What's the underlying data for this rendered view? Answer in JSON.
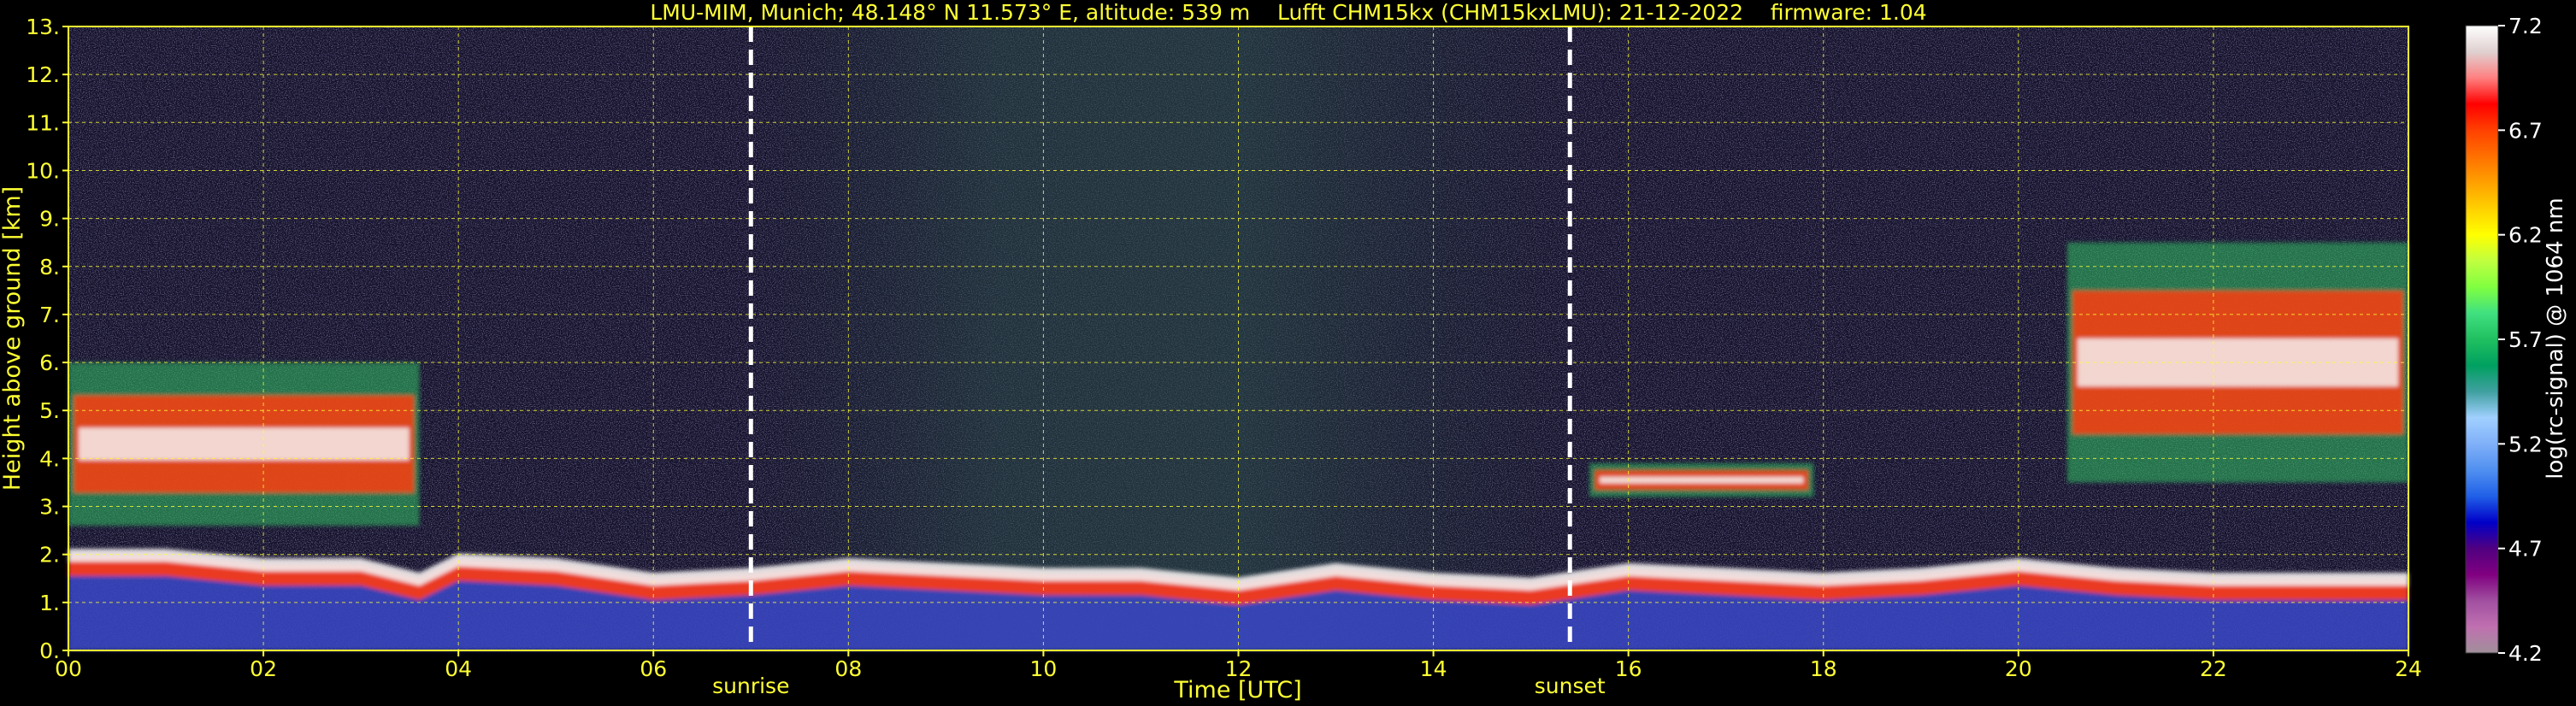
{
  "chart_data": {
    "type": "heatmap",
    "title": "LMU-MIM, Munich; 48.148° N 11.573° E, altitude: 539 m    Lufft CHM15kx (CHM15kxLMU): 21-12-2022    firmware: 1.04",
    "xlabel": "Time [UTC]",
    "ylabel": "Height above ground [km]",
    "colorbar_label": "log(rc-signal) @ 1064 nm",
    "xlim": [
      0,
      24
    ],
    "ylim": [
      0,
      13
    ],
    "x_ticks": [
      0,
      2,
      4,
      6,
      8,
      10,
      12,
      14,
      16,
      18,
      20,
      22,
      24
    ],
    "x_tick_labels": [
      "00",
      "02",
      "04",
      "06",
      "08",
      "10",
      "12",
      "14",
      "16",
      "18",
      "20",
      "22",
      "24"
    ],
    "y_ticks": [
      0,
      1,
      2,
      3,
      4,
      5,
      6,
      7,
      8,
      9,
      10,
      11,
      12,
      13
    ],
    "y_tick_labels": [
      "0.",
      "1.",
      "2.",
      "3.",
      "4.",
      "5.",
      "6.",
      "7.",
      "8.",
      "9.",
      "10.",
      "11.",
      "12.",
      "13."
    ],
    "grid": true,
    "colorbar": {
      "min": 4.2,
      "max": 7.2,
      "ticks": [
        4.2,
        4.7,
        5.2,
        5.7,
        6.2,
        6.7,
        7.2
      ],
      "tick_labels": [
        "4.2",
        "4.7",
        "5.2",
        "5.7",
        "6.2",
        "6.7",
        "7.2"
      ],
      "colors": [
        "#a0909a",
        "#c070b0",
        "#a050a0",
        "#800080",
        "#500080",
        "#0000c8",
        "#2060e8",
        "#5090f0",
        "#80b0f8",
        "#a0d0ff",
        "#40a0a0",
        "#00a060",
        "#20c060",
        "#40e080",
        "#80ff40",
        "#c0ff40",
        "#ffff00",
        "#ffd000",
        "#ffa000",
        "#ff7000",
        "#ff4000",
        "#ff0000",
        "#ff8080",
        "#e0d0d0",
        "#ffffff"
      ]
    },
    "events": [
      {
        "label": "sunrise",
        "x": 7.0
      },
      {
        "label": "sunset",
        "x": 15.4
      }
    ],
    "layers": [
      {
        "name": "aerosol-layer",
        "points": [
          [
            0,
            2.0
          ],
          [
            1,
            2.0
          ],
          [
            2,
            1.8
          ],
          [
            3,
            1.8
          ],
          [
            3.6,
            1.5
          ],
          [
            4,
            1.9
          ],
          [
            5,
            1.8
          ],
          [
            6,
            1.5
          ],
          [
            7,
            1.6
          ],
          [
            8,
            1.8
          ],
          [
            9,
            1.7
          ],
          [
            10,
            1.6
          ],
          [
            11,
            1.6
          ],
          [
            12,
            1.4
          ],
          [
            13,
            1.7
          ],
          [
            14,
            1.5
          ],
          [
            15,
            1.4
          ],
          [
            16,
            1.7
          ],
          [
            17,
            1.6
          ],
          [
            18,
            1.5
          ],
          [
            19,
            1.6
          ],
          [
            20,
            1.8
          ],
          [
            21,
            1.6
          ],
          [
            22,
            1.5
          ],
          [
            23,
            1.5
          ],
          [
            24,
            1.5
          ]
        ]
      },
      {
        "name": "cloud-early-morning",
        "x_start": 0,
        "x_end": 3.6,
        "top": 6.0,
        "base": 2.6
      },
      {
        "name": "cloud-afternoon",
        "x_start": 15.6,
        "x_end": 17.9,
        "top": 3.9,
        "base": 3.2
      },
      {
        "name": "cloud-evening",
        "x_start": 20.5,
        "x_end": 24,
        "top": 8.5,
        "base": 3.5
      }
    ]
  }
}
